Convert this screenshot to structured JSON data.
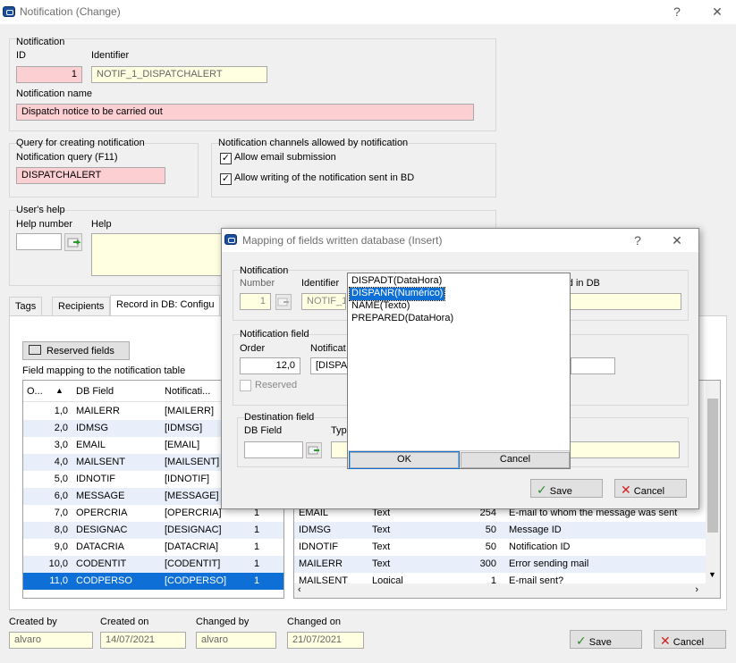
{
  "window": {
    "title": "Notification (Change)",
    "help": "?",
    "close": "✕"
  },
  "notification": {
    "group_label": "Notification",
    "id_label": "ID",
    "id_value": "1",
    "identifier_label": "Identifier",
    "identifier_value": "NOTIF_1_DISPATCHALERT",
    "name_label": "Notification name",
    "name_value": "Dispatch notice to be carried out"
  },
  "query": {
    "group_label": "Query for creating notification",
    "field_label": "Notification query (F11)",
    "field_value": "DISPATCHALERT"
  },
  "channels": {
    "group_label": "Notification channels allowed by notification",
    "email_label": "Allow email submission",
    "email_checked": "✓",
    "writing_label": "Allow writing of the notification sent in BD",
    "writing_checked": "✓"
  },
  "help": {
    "group_label": "User's help",
    "number_label": "Help number",
    "help_label": "Help"
  },
  "tabs": [
    "Tags",
    "Recipients",
    "Record in DB: Configu"
  ],
  "reserved_button": "Reserved fields",
  "mapping_label": "Field mapping to the notification table",
  "left_grid": {
    "headers": [
      "O...",
      "DB Field",
      "Notificati..."
    ],
    "rows": [
      {
        "order": "1,0",
        "field": "MAILERR",
        "notif": "[MAILERR]",
        "extra": ""
      },
      {
        "order": "2,0",
        "field": "IDMSG",
        "notif": "[IDMSG]",
        "extra": ""
      },
      {
        "order": "3,0",
        "field": "EMAIL",
        "notif": "[EMAIL]",
        "extra": ""
      },
      {
        "order": "4,0",
        "field": "MAILSENT",
        "notif": "[MAILSENT]",
        "extra": ""
      },
      {
        "order": "5,0",
        "field": "IDNOTIF",
        "notif": "[IDNOTIF]",
        "extra": ""
      },
      {
        "order": "6,0",
        "field": "MESSAGE",
        "notif": "[MESSAGE]",
        "extra": ""
      },
      {
        "order": "7,0",
        "field": "OPERCRIA",
        "notif": "[OPERCRIA]",
        "extra": "1"
      },
      {
        "order": "8,0",
        "field": "DESIGNAC",
        "notif": "[DESIGNAC]",
        "extra": "1"
      },
      {
        "order": "9,0",
        "field": "DATACRIA",
        "notif": "[DATACRIA]",
        "extra": "1"
      },
      {
        "order": "10,0",
        "field": "CODENTIT",
        "notif": "[CODENTIT]",
        "extra": "1"
      },
      {
        "order": "11,0",
        "field": "CODPERSO",
        "notif": "[CODPERSO]",
        "extra": "1"
      }
    ]
  },
  "right_grid": {
    "rows": [
      {
        "field": "EMAIL",
        "type": "Text",
        "size": "254",
        "desc": "E-mail to whom the message was sent"
      },
      {
        "field": "IDMSG",
        "type": "Text",
        "size": "50",
        "desc": "Message ID"
      },
      {
        "field": "IDNOTIF",
        "type": "Text",
        "size": "50",
        "desc": "Notification ID"
      },
      {
        "field": "MAILERR",
        "type": "Text",
        "size": "300",
        "desc": "Error sending mail"
      },
      {
        "field": "MAILSENT",
        "type": "Logical",
        "size": "1",
        "desc": "E-mail sent?"
      }
    ]
  },
  "footer": {
    "created_by_label": "Created by",
    "created_by": "alvaro",
    "created_on_label": "Created on",
    "created_on": "14/07/2021",
    "changed_by_label": "Changed by",
    "changed_by": "alvaro",
    "changed_on_label": "Changed on",
    "changed_on": "21/07/2021",
    "save": "Save",
    "cancel": "Cancel"
  },
  "dialog": {
    "title": "Mapping of fields written database (Insert)",
    "help": "?",
    "close": "✕",
    "notif_group": "Notification",
    "number_label": "Number",
    "number_value": "1",
    "identifier_label": "Identifier",
    "identifier_value": "NOTIF_1",
    "record_label": "ord in DB",
    "nfield_group": "Notification field",
    "order_label": "Order",
    "order_value": "12,0",
    "notif_label": "Notificat",
    "notif_value": "[DISPAN",
    "reserved_label": "Reserved",
    "dest_group": "Destination field",
    "dbfield_label": "DB Field",
    "type_label": "Typ",
    "save": "Save",
    "cancel": "Cancel"
  },
  "popup": {
    "items": [
      "DISPADT(DataHora)",
      "DISPANR(Numérico)",
      "NAME(Texto)",
      "PREPARED(DataHora)"
    ],
    "ok": "OK",
    "cancel": "Cancel"
  }
}
